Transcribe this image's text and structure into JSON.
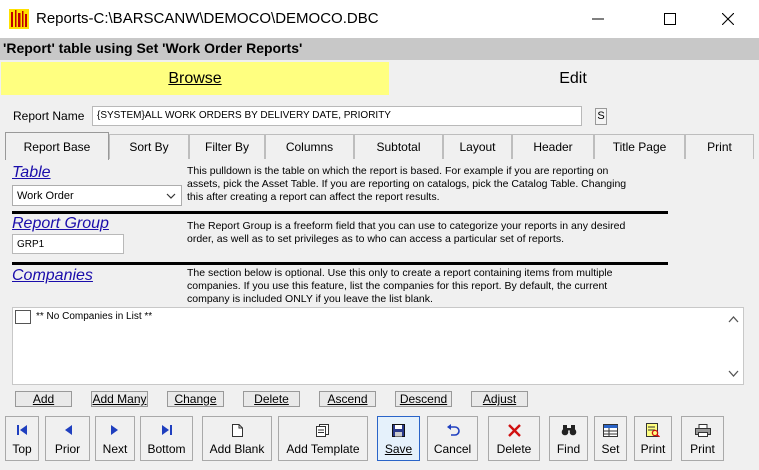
{
  "window": {
    "title": "Reports-C:\\BARSCANW\\DEMOCO\\DEMOCO.DBC",
    "minimize_glyph": "—",
    "maximize_glyph": "☐",
    "close_glyph": "✕"
  },
  "banner": "'Report' table using Set 'Work Order Reports'",
  "main_tabs": {
    "browse": "Browse",
    "edit": "Edit"
  },
  "report_name": {
    "label": "Report Name",
    "value": "{SYSTEM}ALL WORK ORDERS BY DELIVERY DATE, PRIORITY",
    "s_button": "S"
  },
  "sub_tabs": [
    "Report Base",
    "Sort By",
    "Filter By",
    "Columns",
    "Subtotal",
    "Layout",
    "Header",
    "Title Page",
    "Print"
  ],
  "table_section": {
    "title": "Table",
    "desc": [
      "This pulldown is the table on which the report is based.  For example if you are reporting on",
      "assets, pick the Asset Table.  If you are reporting on catalogs, pick the Catalog Table.  Changing",
      "this after creating a report can affect the report results."
    ],
    "selected": "Work Order"
  },
  "group_section": {
    "title": "Report Group",
    "desc": [
      "The Report Group is a freeform field that you can use to categorize your reports in any desired",
      "order, as well as to set privileges as to who can access a particular set of reports."
    ],
    "value": "GRP1"
  },
  "companies_section": {
    "title": "Companies",
    "desc": [
      "The section below is optional.  Use this only to create a report containing items from multiple",
      "companies.  If you use this feature, list the companies for this report.  By default, the current",
      "company is included ONLY if you leave the list blank."
    ],
    "list_item": "** No Companies in List **"
  },
  "list_buttons": [
    "Add",
    "Add Many",
    "Change",
    "Delete",
    "Ascend",
    "Descend",
    "Adjust"
  ],
  "toolbar": {
    "top": "Top",
    "prior": "Prior",
    "next": "Next",
    "bottom": "Bottom",
    "add_blank": "Add Blank",
    "add_template": "Add Template",
    "save": "Save",
    "cancel": "Cancel",
    "delete": "Delete",
    "find": "Find",
    "set": "Set",
    "print1": "Print",
    "print2": "Print"
  },
  "colors": {
    "browse_tab_bg": "#ffff80",
    "link_blue": "#1a0dab",
    "nav_arrow_blue": "#1f3fbf",
    "delete_red": "#d01010"
  }
}
